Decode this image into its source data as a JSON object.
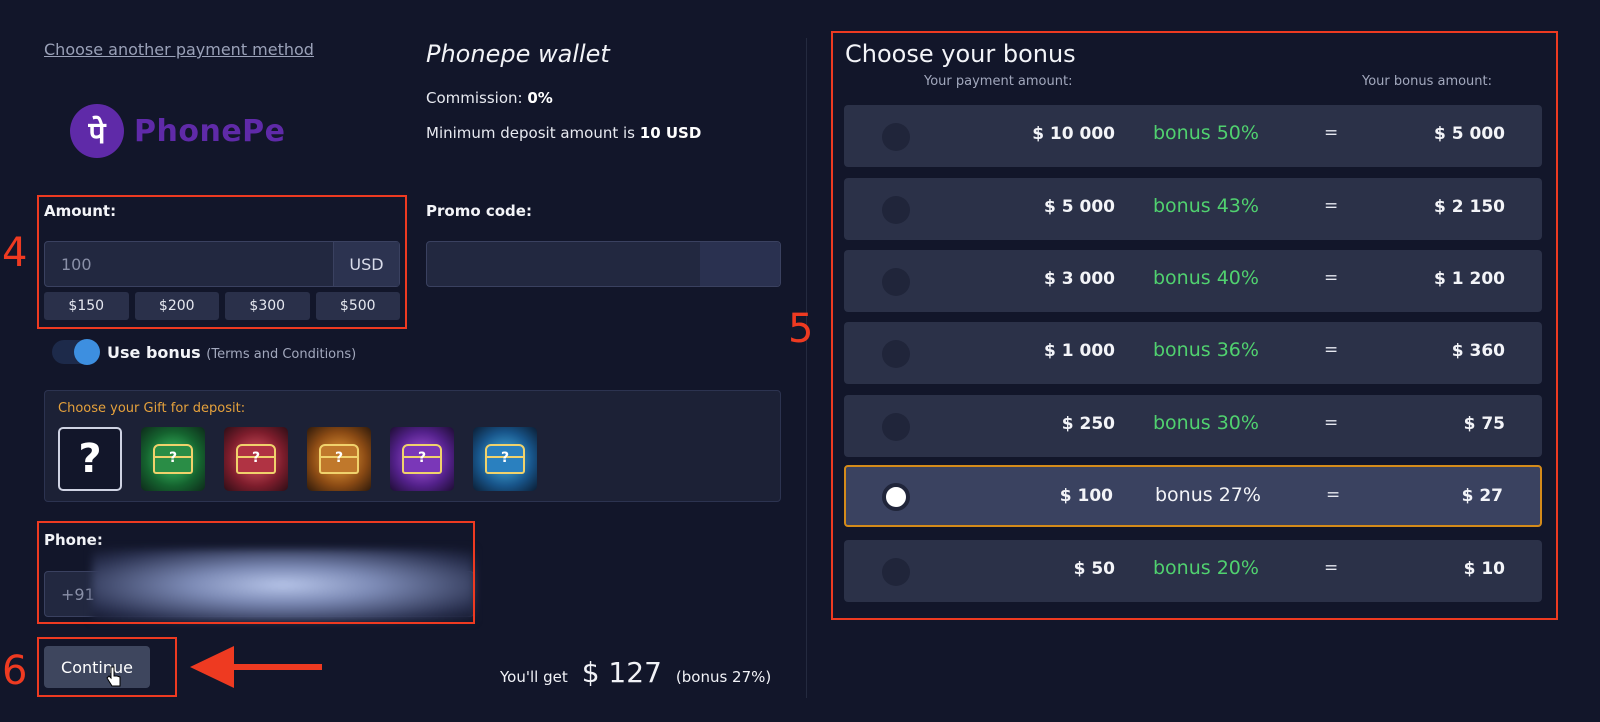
{
  "payment": {
    "choose_another": "Choose another payment method",
    "logo_glyph": "पे",
    "logo_text": "PhonePe",
    "wallet_title": "Phonepe wallet",
    "commission_label": "Commission:",
    "commission_value": "0%",
    "min_deposit_label": "Minimum deposit amount is",
    "min_deposit_value": "10 USD"
  },
  "amount": {
    "label": "Amount:",
    "placeholder": "100",
    "currency": "USD",
    "quick": [
      "$150",
      "$200",
      "$300",
      "$500"
    ]
  },
  "promo": {
    "label": "Promo code:"
  },
  "use_bonus": {
    "label": "Use bonus",
    "terms": "(Terms and Conditions)"
  },
  "gift": {
    "label": "Choose your Gift for deposit:",
    "mystery": "?"
  },
  "phone": {
    "label": "Phone:",
    "prefix": "+91"
  },
  "continue_label": "Continue",
  "summary": {
    "label": "You'll get",
    "value": "$ 127",
    "bonus": "(bonus 27%)"
  },
  "bonus_panel": {
    "title": "Choose your bonus",
    "sub_left": "Your payment amount:",
    "sub_right": "Your bonus amount:",
    "equals": "=",
    "rows": [
      {
        "pay": "$ 10 000",
        "pct": "bonus 50%",
        "amt": "$ 5 000"
      },
      {
        "pay": "$ 5 000",
        "pct": "bonus 43%",
        "amt": "$ 2 150"
      },
      {
        "pay": "$ 3 000",
        "pct": "bonus 40%",
        "amt": "$ 1 200"
      },
      {
        "pay": "$ 1 000",
        "pct": "bonus 36%",
        "amt": "$ 360"
      },
      {
        "pay": "$ 250",
        "pct": "bonus 30%",
        "amt": "$ 75"
      },
      {
        "pay": "$ 100",
        "pct": "bonus 27%",
        "amt": "$ 27"
      },
      {
        "pay": "$ 50",
        "pct": "bonus 20%",
        "amt": "$ 10"
      }
    ],
    "selected_row": 5
  },
  "annotations": {
    "step4": "4",
    "step5": "5",
    "step6": "6"
  },
  "colors": {
    "background": "#12162a",
    "accent_green": "#50d16f",
    "highlight_orange": "#d48b1a",
    "annotation_red": "#ee3a21"
  },
  "icons": [
    "phonepe-logo-icon",
    "toggle-icon",
    "gift-chest-icon",
    "pointer-cursor-icon",
    "arrow-left-icon",
    "radio-icon"
  ]
}
